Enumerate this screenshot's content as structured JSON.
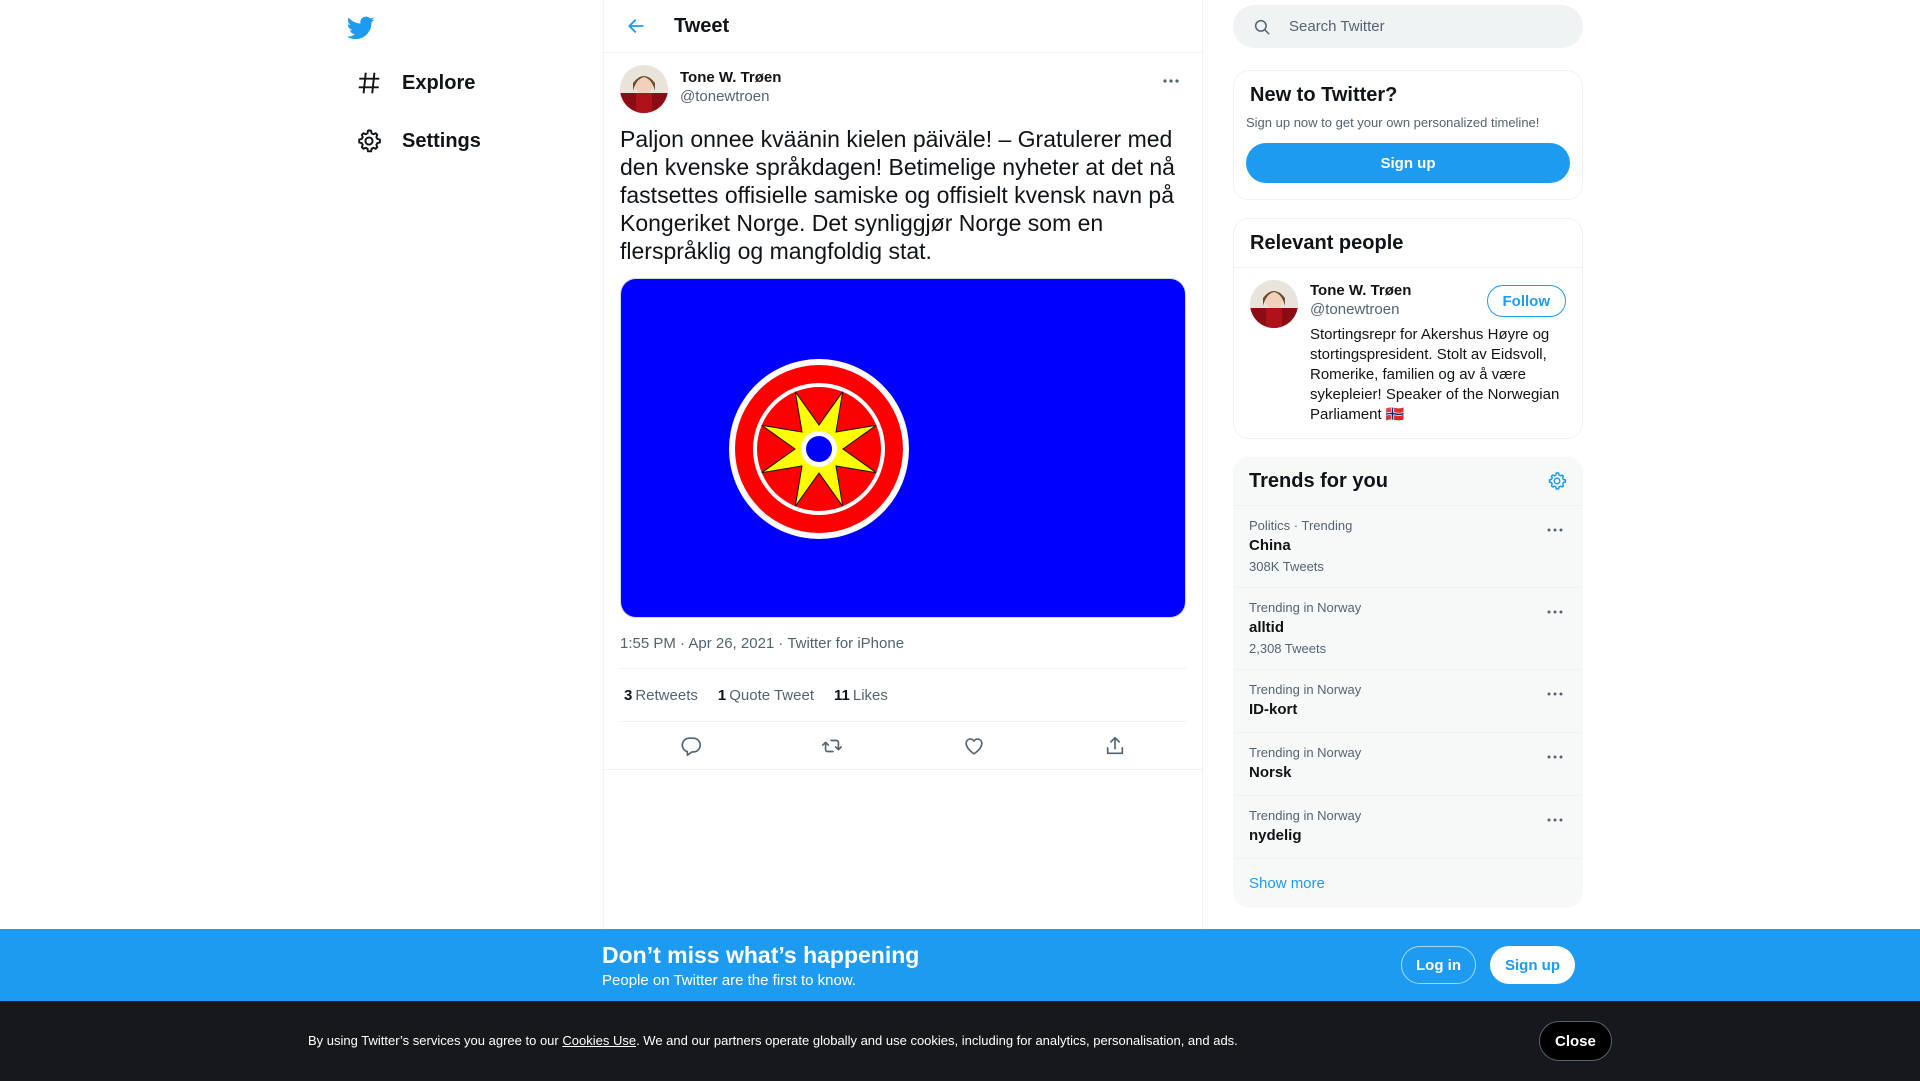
{
  "nav": {
    "items": [
      {
        "label": "Explore",
        "icon": "hashtag-icon"
      },
      {
        "label": "Settings",
        "icon": "gear-icon"
      }
    ]
  },
  "header": {
    "title": "Tweet"
  },
  "tweet": {
    "author_name": "Tone W. Trøen",
    "author_handle": "@tonewtroen",
    "text": "Paljon onnee kväänin kielen päiväle! – Gratulerer med den kvenske språkdagen! Betimelige nyheter at det nå fastsettes offisielle samiske og offisielt kvensk navn på Kongeriket Norge. Det synliggjør Norge som en flerspråklig og mangfoldig stat.",
    "timestamp": "1:55 PM · Apr 26, 2021 · Twitter for iPhone",
    "stats": {
      "retweets_count": "3",
      "retweets_label": "Retweets",
      "quotes_count": "1",
      "quotes_label": "Quote Tweet",
      "likes_count": "11",
      "likes_label": "Likes"
    }
  },
  "search": {
    "placeholder": "Search Twitter"
  },
  "new_to_twitter": {
    "title": "New to Twitter?",
    "description": "Sign up now to get your own personalized timeline!",
    "button": "Sign up"
  },
  "relevant_people": {
    "title": "Relevant people",
    "person": {
      "name": "Tone W. Trøen",
      "handle": "@tonewtroen",
      "bio": "Stortingsrepr for Akershus Høyre og stortingspresident. Stolt av Eidsvoll, Romerike, familien og av å være sykepleier! Speaker of the Norwegian Parliament 🇳🇴",
      "follow": "Follow"
    }
  },
  "trends": {
    "title": "Trends for you",
    "items": [
      {
        "context": "Politics · Trending",
        "name": "China",
        "count": "308K Tweets"
      },
      {
        "context": "Trending in Norway",
        "name": "alltid",
        "count": "2,308 Tweets"
      },
      {
        "context": "Trending in Norway",
        "name": "ID-kort",
        "count": ""
      },
      {
        "context": "Trending in Norway",
        "name": "Norsk",
        "count": ""
      },
      {
        "context": "Trending in Norway",
        "name": "nydelig",
        "count": ""
      }
    ],
    "show_more": "Show more"
  },
  "banner": {
    "title": "Don’t miss what’s happening",
    "subtitle": "People on Twitter are the first to know.",
    "login": "Log in",
    "signup": "Sign up"
  },
  "cookies": {
    "text_before": "By using Twitter’s services you agree to our ",
    "link": "Cookies Use",
    "text_after": ". We and our partners operate globally and use cookies, including for analytics, personalisation, and ads.",
    "close": "Close"
  },
  "colors": {
    "accent": "#1d9bf0",
    "flag_blue": "#0000ff",
    "flag_red": "#ff0000",
    "flag_yellow": "#ffff00"
  }
}
